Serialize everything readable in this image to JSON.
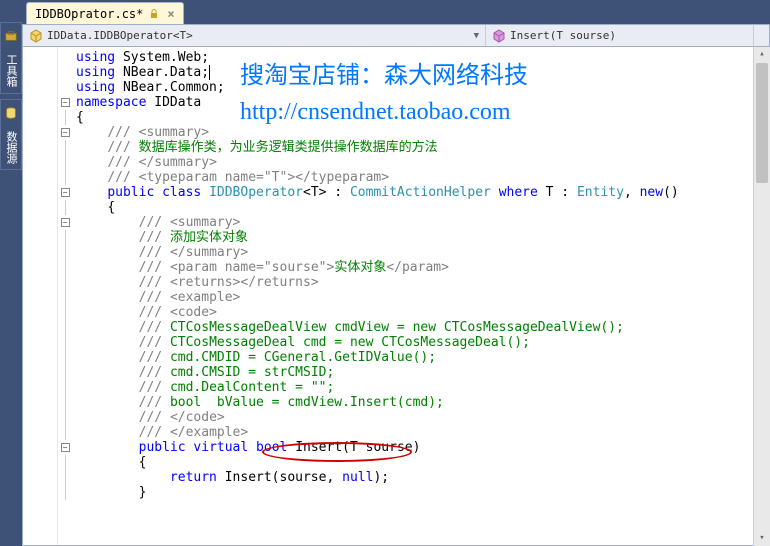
{
  "sidebar": {
    "tabs": [
      {
        "label": "工具箱"
      },
      {
        "label": "数据源"
      }
    ]
  },
  "file_tab": {
    "name": "IDDBOprator.cs*",
    "close": "×"
  },
  "nav": {
    "left": "IDData.IDDBOperator<T>",
    "right": "Insert(T sourse)"
  },
  "watermark": {
    "line1": "搜淘宝店铺：森大网络科技",
    "line2": "http://cnsendnet.taobao.com"
  },
  "code": {
    "l1": {
      "kw": "using",
      "t": " System.Web;"
    },
    "l2": {
      "kw": "using",
      "t": " NBear.Data;"
    },
    "l3": {
      "kw": "using",
      "t": " NBear.Common;"
    },
    "l4": {
      "kw": "namespace",
      "t": " IDData"
    },
    "l5": "{",
    "l6": {
      "a": "/// ",
      "b": "<summary>"
    },
    "l7": {
      "a": "/// ",
      "b": "数据库操作类，为业务逻辑类提供操作数据库的方法"
    },
    "l8": {
      "a": "/// ",
      "b": "</summary>"
    },
    "l9": {
      "a": "/// ",
      "b": "<typeparam name=\"T\"></typeparam>"
    },
    "l10": {
      "kw": "public",
      "kw2": "class",
      "name": "IDDBOperator",
      "kw3": "where",
      "base": "CommitActionHelper",
      "ent": "Entity",
      "new": "new"
    },
    "l11": "{",
    "l12": {
      "a": "/// ",
      "b": "<summary>"
    },
    "l13": {
      "a": "/// ",
      "b": "添加实体对象"
    },
    "l14": {
      "a": "/// ",
      "b": "</summary>"
    },
    "l15": {
      "a": "/// ",
      "b": "<param name=\"sourse\">",
      "c": "实体对象",
      "d": "</param>"
    },
    "l16": {
      "a": "/// ",
      "b": "<returns></returns>"
    },
    "l17": {
      "a": "/// ",
      "b": "<example>"
    },
    "l18": {
      "a": "/// ",
      "b": "<code>"
    },
    "l19": {
      "a": "/// ",
      "b": "CTCosMessageDealView cmdView = new CTCosMessageDealView();"
    },
    "l20": {
      "a": "/// ",
      "b": "CTCosMessageDeal cmd = new CTCosMessageDeal();"
    },
    "l21": {
      "a": "/// ",
      "b": "cmd.CMDID = CGeneral.GetIDValue();"
    },
    "l22": {
      "a": "/// ",
      "b": "cmd.CMSID = strCMSID;"
    },
    "l23": {
      "a": "/// ",
      "b": "cmd.DealContent = \"\";"
    },
    "l24": {
      "a": "/// ",
      "b": "bool  bValue = cmdView.Insert(cmd);"
    },
    "l25": {
      "a": "/// ",
      "b": "</code>"
    },
    "l26": {
      "a": "/// ",
      "b": "</example>"
    },
    "l27": {
      "kw": "public",
      "kw2": "virtual",
      "kw3": "bool",
      "name": "Insert",
      "p": "(T sourse)"
    },
    "l28": "{",
    "l29": {
      "kw": "return",
      "t": " Insert(sourse, ",
      "kw2": "null",
      "e": ");"
    },
    "l30": "}"
  }
}
